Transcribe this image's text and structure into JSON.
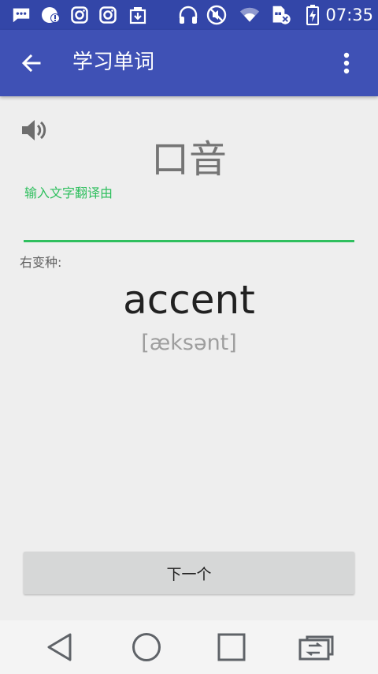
{
  "status_bar": {
    "time": "07:35",
    "icons": [
      "chat-bubble-icon",
      "cloud-alert-icon",
      "instagram-icon",
      "instagram-icon",
      "download-box-icon",
      "headphones-icon",
      "mute-icon",
      "wifi-icon",
      "sim-error-icon",
      "battery-charging-icon"
    ]
  },
  "app_bar": {
    "title": "学习单词",
    "back_icon": "arrow-back-icon",
    "menu_icon": "more-vert-icon"
  },
  "content": {
    "speaker_icon": "volume-icon",
    "prompt_word": "口音",
    "input_label": "输入文字翻译由",
    "input_value": "",
    "variant_label": "右变种:",
    "answer_word": "accent",
    "phonetic": "[æksənt]",
    "next_button": "下一个"
  },
  "nav_bar": {
    "icons": [
      "back-triangle-icon",
      "home-circle-icon",
      "recents-square-icon",
      "screen-switch-icon"
    ]
  },
  "colors": {
    "status_bar": "#3346a8",
    "app_bar": "#3f51b5",
    "accent_green": "#2fbf5e",
    "background": "#eeeeee"
  }
}
